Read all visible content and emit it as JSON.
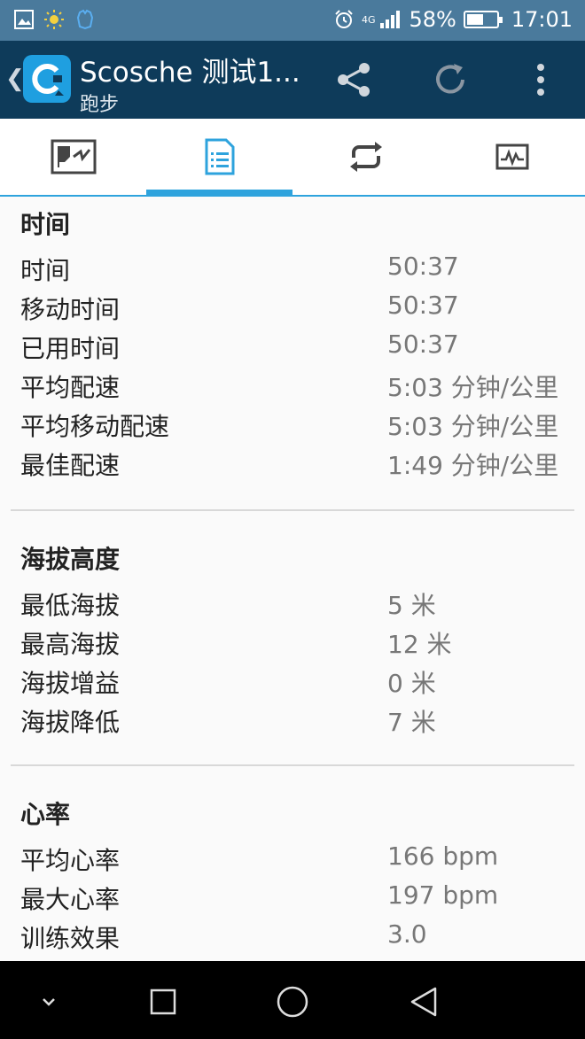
{
  "status_bar": {
    "battery": "58%",
    "time": "17:01",
    "network": "4G",
    "battery_level": 0.58
  },
  "header": {
    "title": "Scosche 测试1...",
    "subtitle": "跑步"
  },
  "tabs": [
    {
      "icon": "map-icon",
      "active": false
    },
    {
      "icon": "summary-list-icon",
      "active": true
    },
    {
      "icon": "laps-icon",
      "active": false
    },
    {
      "icon": "chart-icon",
      "active": false
    }
  ],
  "sections": [
    {
      "title": "时间",
      "rows": [
        {
          "label": "时间",
          "value": "50:37"
        },
        {
          "label": "移动时间",
          "value": "50:37"
        },
        {
          "label": "已用时间",
          "value": "50:37"
        },
        {
          "label": "平均配速",
          "value": "5:03 分钟/公里"
        },
        {
          "label": "平均移动配速",
          "value": "5:03 分钟/公里"
        },
        {
          "label": "最佳配速",
          "value": "1:49 分钟/公里"
        }
      ]
    },
    {
      "title": "海拔高度",
      "rows": [
        {
          "label": "最低海拔",
          "value": "5 米"
        },
        {
          "label": "最高海拔",
          "value": "12 米"
        },
        {
          "label": "海拔增益",
          "value": "0 米"
        },
        {
          "label": "海拔降低",
          "value": "7 米"
        }
      ]
    },
    {
      "title": "心率",
      "rows": [
        {
          "label": "平均心率",
          "value": "166 bpm"
        },
        {
          "label": "最大心率",
          "value": "197 bpm"
        },
        {
          "label": "训练效果",
          "value": "3.0"
        }
      ]
    }
  ],
  "colors": {
    "status_bar": "#4a7a9c",
    "action_bar": "#0e3b5a",
    "accent": "#2ea3dd"
  }
}
